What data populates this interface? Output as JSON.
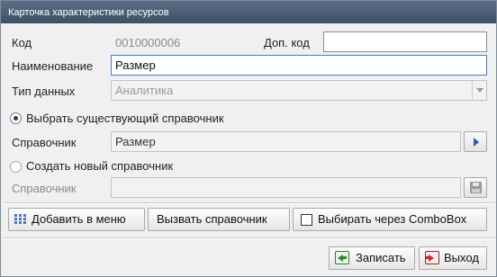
{
  "window": {
    "title": "Карточка характеристики  ресурсов"
  },
  "fields": {
    "code_label": "Код",
    "code_value": "0010000006",
    "extra_code_label": "Доп. код",
    "extra_code_value": "",
    "name_label": "Наименование",
    "name_value": "Размер",
    "data_type_label": "Тип данных",
    "data_type_value": "Аналитика"
  },
  "options": {
    "select_existing_label": "Выбрать существующий справочник",
    "select_existing_checked": true,
    "directory_label": "Справочник",
    "directory_value": "Размер",
    "create_new_label": "Создать новый справочник",
    "create_new_checked": false,
    "new_directory_label": "Справочник",
    "new_directory_value": ""
  },
  "actions": {
    "add_to_menu": "Добавить в меню",
    "call_directory": "Вызвать справочник",
    "combobox_label": "Выбирать через ComboBox",
    "combobox_checked": false
  },
  "footer": {
    "save": "Записать",
    "exit": "Выход"
  }
}
